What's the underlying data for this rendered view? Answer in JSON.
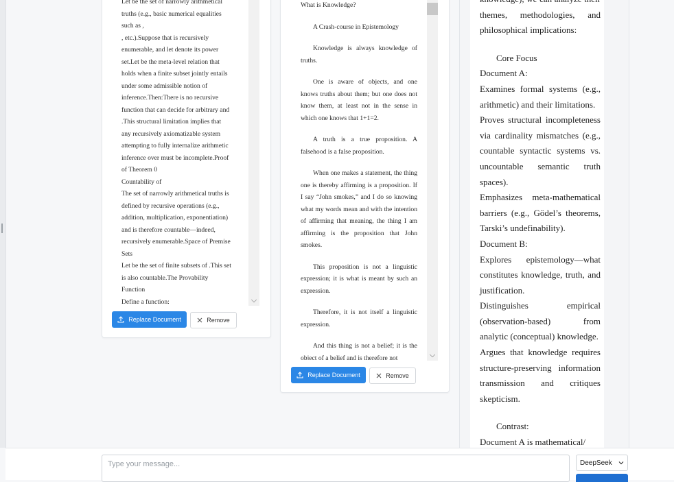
{
  "doc1": {
    "lines": [
      "Let be the set of narrowly arithmetical",
      "truths (e.g., basic numerical equalities",
      "such as ,",
      ", etc.).Suppose that is recursively",
      "enumerable, and let denote its power",
      "set.Let be the meta-level relation that",
      "holds when a finite subset jointly entails",
      "under some admissible notion of",
      "inference.Then:There is no recursive",
      "function that can decide for arbitrary and",
      ".This structural limitation implies that",
      "any recursively axiomatizable system",
      "attempting to fully internalize arithmetic",
      "inference over must be incomplete.Proof",
      "of Theorem 0",
      "Countability of",
      "The set of narrowly arithmetical truths is",
      "defined by recursive operations (e.g.,",
      "addition, multiplication, exponentiation)",
      "and is therefore countable—indeed,",
      "recursively enumerable.Space of Premise",
      "Sets",
      "Let be the set of finite subsets of .This set",
      "is also countable.The Provability",
      "Function",
      "Define a function:"
    ],
    "replace_label": "Replace Document",
    "remove_label": "Remove"
  },
  "doc2": {
    "paragraphs": [
      "What is Knowledge?",
      "A Crash-course in Epistemology",
      "Knowledge is always knowledge of truths.",
      "One is aware of objects, and one knows truths about them; but one does not know them, at least not in the sense in which one knows that 1+1=2.",
      "A truth is a true proposition. A falsehood is a false proposition.",
      "When one makes a statement, the thing one is thereby affirming is a proposition. If I say “John smokes,” and I do so knowing what my words mean and with the intention of affirming that meaning, the thing I am affirming is the proposition that John smokes.",
      "This proposition is not a linguistic expression; it is what is meant by such an expression.",
      "Therefore, it is not itself a linguistic expression.",
      "And this thing is not a belief; it is the object of a belief and is therefore not"
    ],
    "replace_label": "Replace Document",
    "remove_label": "Remove"
  },
  "analysis": {
    "blocks": [
      {
        "text": "knowledge), we can analyze their themes, methodologies, and philosophical implications:",
        "indent": false,
        "gap": false
      },
      {
        "text": "Core Focus",
        "indent": true,
        "gap": true
      },
      {
        "text": "Document A:",
        "indent": false,
        "gap": false
      },
      {
        "text": "Examines formal systems (e.g., arithmetic) and their limitations.",
        "indent": false,
        "gap": false
      },
      {
        "text": "Proves structural incompleteness via cardinality mismatches (e.g., countable syntactic systems vs. uncountable semantic truth spaces).",
        "indent": false,
        "gap": false
      },
      {
        "text": "Emphasizes meta-mathematical barriers (e.g., Gödel’s theorems, Tarski’s undefinability).",
        "indent": false,
        "gap": false
      },
      {
        "text": "Document B:",
        "indent": false,
        "gap": false
      },
      {
        "text": "Explores epistemology—what constitutes knowledge, truth, and justification.",
        "indent": false,
        "gap": false
      },
      {
        "text": "Distinguishes empirical (observation-based) from analytic (conceptual) knowledge.",
        "indent": false,
        "gap": false
      },
      {
        "text": "Argues that knowledge requires structure-preserving information transmission and critiques skepticism.",
        "indent": false,
        "gap": false
      },
      {
        "text": "Contrast:",
        "indent": true,
        "gap": true
      },
      {
        "text": "Document A is mathematical/",
        "indent": false,
        "gap": false
      }
    ]
  },
  "composer": {
    "placeholder": "Type your message...",
    "model": "DeepSeek"
  },
  "colors": {
    "primary": "#2b87e6",
    "send": "#1f6fd1"
  }
}
